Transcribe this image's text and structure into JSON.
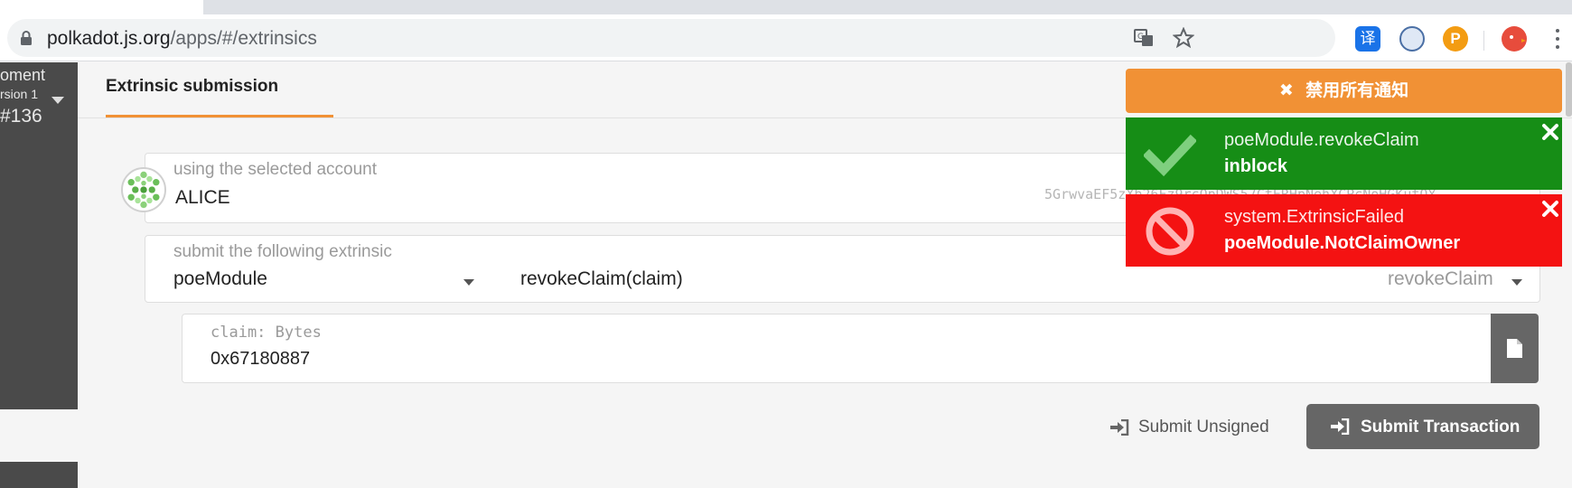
{
  "browser": {
    "url_host": "polkadot.js.org",
    "url_path": "/apps/#/extrinsics",
    "ext_translate_glyph": "译",
    "ext_p_glyph": "P"
  },
  "sidebar": {
    "chain_name": "oment",
    "version": "rsion 1",
    "block": "#136"
  },
  "tabs": [
    {
      "label": "Extrinsic submission",
      "active": true
    }
  ],
  "account": {
    "label": "using the selected account",
    "name": "ALICE",
    "address": "5GrwvaEF5zXb26Fz9rcQpDWS57CtERHpNehXCPcNoHGKutQY"
  },
  "extrinsic": {
    "label": "submit the following extrinsic",
    "module": "poeModule",
    "call": "revokeClaim(claim)",
    "call_short": "revokeClaim"
  },
  "param": {
    "label": "claim: Bytes",
    "value": "0x67180887"
  },
  "actions": {
    "unsigned": "Submit Unsigned",
    "submit": "Submit Transaction"
  },
  "notifications": {
    "disable_all": "禁用所有通知",
    "items": [
      {
        "title": "poeModule.revokeClaim",
        "status": "inblock",
        "kind": "success"
      },
      {
        "title": "system.ExtrinsicFailed",
        "status": "poeModule.NotClaimOwner",
        "kind": "error"
      }
    ]
  },
  "colors": {
    "accent": "#f19135",
    "success": "#168d16",
    "error": "#f41212",
    "sidebar": "#4a4a4a",
    "button": "#666666"
  }
}
